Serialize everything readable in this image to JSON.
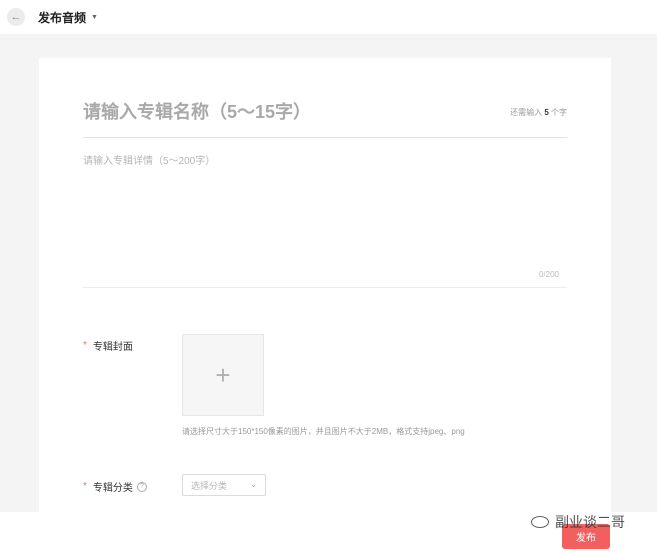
{
  "header": {
    "title": "发布音频",
    "back_icon": "arrow-left-icon"
  },
  "form": {
    "name_placeholder": "请输入专辑名称（5～15字）",
    "name_remaining_prefix": "还需输入",
    "name_remaining_count": "5",
    "name_remaining_suffix": "个字",
    "desc_placeholder": "请输入专辑详情（5～200字）",
    "desc_count": "0/200",
    "cover_label": "专辑封面",
    "cover_hint": "请选择尺寸大于150*150像素的图片，并且图片不大于2MB，格式支持jpeg、png",
    "category_label": "专辑分类",
    "category_placeholder": "选择分类",
    "required_mark": "*"
  },
  "footer": {
    "publish_label": "发布"
  },
  "watermark": {
    "text": "副业谈二哥"
  },
  "colors": {
    "accent": "#f25f5f",
    "background": "#f4f4f4"
  }
}
